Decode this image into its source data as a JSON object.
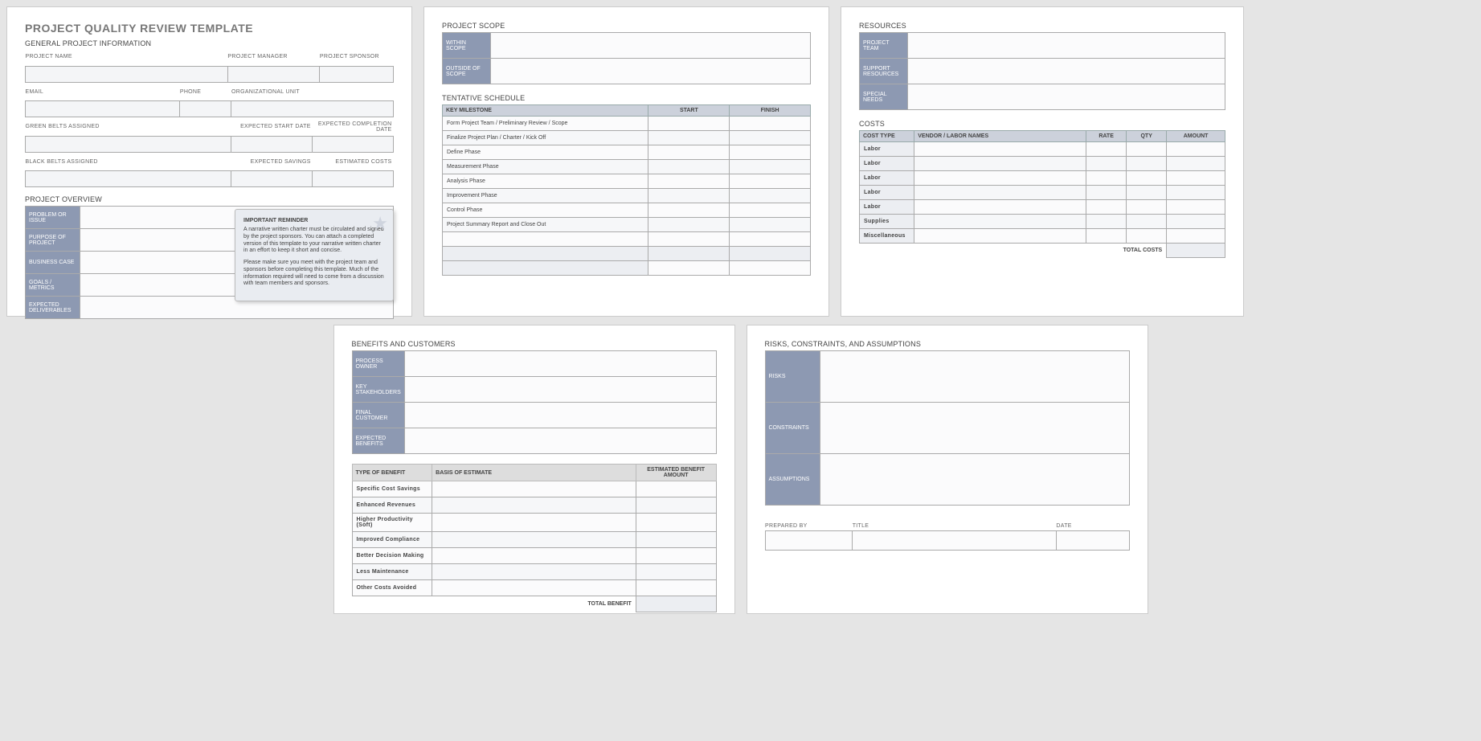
{
  "title": "PROJECT QUALITY REVIEW TEMPLATE",
  "sections": {
    "general": "GENERAL PROJECT INFORMATION",
    "overview": "PROJECT OVERVIEW",
    "scope": "PROJECT SCOPE",
    "schedule": "TENTATIVE SCHEDULE",
    "resources": "RESOURCES",
    "costs": "COSTS",
    "benefits": "BENEFITS AND CUSTOMERS",
    "rca": "RISKS, CONSTRAINTS, AND ASSUMPTIONS"
  },
  "labels": {
    "project_name": "PROJECT NAME",
    "project_manager": "PROJECT MANAGER",
    "project_sponsor": "PROJECT SPONSOR",
    "email": "EMAIL",
    "phone": "PHONE",
    "org_unit": "ORGANIZATIONAL UNIT",
    "green_belts": "GREEN BELTS ASSIGNED",
    "exp_start": "EXPECTED START DATE",
    "exp_completion": "EXPECTED COMPLETION DATE",
    "black_belts": "BLACK BELTS ASSIGNED",
    "exp_savings": "EXPECTED SAVINGS",
    "est_costs": "ESTIMATED COSTS",
    "prepared_by": "PREPARED BY",
    "title_lbl": "TITLE",
    "date": "DATE"
  },
  "overview_rows": [
    "PROBLEM OR ISSUE",
    "PURPOSE OF PROJECT",
    "BUSINESS CASE",
    "GOALS / METRICS",
    "EXPECTED DELIVERABLES"
  ],
  "reminder": {
    "heading": "IMPORTANT REMINDER",
    "p1": "A narrative written charter must be circulated and signed by the project sponsors. You can attach a completed version of this template to your narrative written charter in an effort to keep it short and concise.",
    "p2": "Please make sure you meet with the project team and sponsors before completing this template. Much of the information required will need to come from a discussion with team members and sponsors."
  },
  "scope_rows": [
    "WITHIN SCOPE",
    "OUTSIDE OF SCOPE"
  ],
  "schedule": {
    "headers": [
      "KEY MILESTONE",
      "START",
      "FINISH"
    ],
    "rows": [
      "Form Project Team / Preliminary Review / Scope",
      "Finalize Project Plan / Charter / Kick Off",
      "Define Phase",
      "Measurement Phase",
      "Analysis Phase",
      "Improvement Phase",
      "Control Phase",
      "Project Summary Report and Close Out"
    ]
  },
  "resources_rows": [
    "PROJECT TEAM",
    "SUPPORT RESOURCES",
    "SPECIAL NEEDS"
  ],
  "costs": {
    "headers": [
      "COST TYPE",
      "VENDOR / LABOR NAMES",
      "RATE",
      "QTY",
      "AMOUNT"
    ],
    "rows": [
      "Labor",
      "Labor",
      "Labor",
      "Labor",
      "Labor",
      "Supplies",
      "Miscellaneous"
    ],
    "total_label": "TOTAL COSTS"
  },
  "benefits_rows": [
    "PROCESS OWNER",
    "KEY STAKEHOLDERS",
    "FINAL CUSTOMER",
    "EXPECTED BENEFITS"
  ],
  "benefits_grid": {
    "headers": [
      "TYPE OF BENEFIT",
      "BASIS OF ESTIMATE",
      "ESTIMATED BENEFIT AMOUNT"
    ],
    "rows": [
      "Specific Cost Savings",
      "Enhanced Revenues",
      "Higher Productivity (Soft)",
      "Improved Compliance",
      "Better Decision Making",
      "Less Maintenance",
      "Other Costs Avoided"
    ],
    "total_label": "TOTAL BENEFIT"
  },
  "rca_rows": [
    "RISKS",
    "CONSTRAINTS",
    "ASSUMPTIONS"
  ]
}
